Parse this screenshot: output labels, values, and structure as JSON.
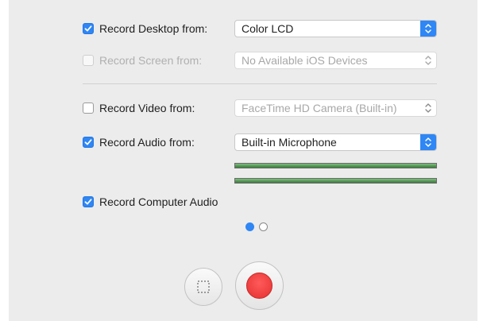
{
  "settings": {
    "record_desktop": {
      "label": "Record Desktop from:",
      "checked": true,
      "value": "Color LCD"
    },
    "record_screen": {
      "label": "Record Screen from:",
      "checked": false,
      "disabled": true,
      "value": "No Available iOS Devices"
    },
    "record_video": {
      "label": "Record Video from:",
      "checked": false,
      "value": "FaceTime HD Camera (Built-in)"
    },
    "record_audio": {
      "label": "Record Audio from:",
      "checked": true,
      "value": "Built-in Microphone"
    },
    "record_computer_audio": {
      "label": "Record Computer Audio",
      "checked": true
    }
  },
  "audio_meters": [
    {
      "level": 1.0
    },
    {
      "level": 1.0
    }
  ],
  "pagination": {
    "pages": 2,
    "current": 1
  },
  "controls": {
    "select_area_icon": "dashed-rectangle-icon",
    "record_icon": "record-icon"
  },
  "colors": {
    "accent": "#2f86f5",
    "record": "#e53030",
    "background": "#ececec"
  }
}
